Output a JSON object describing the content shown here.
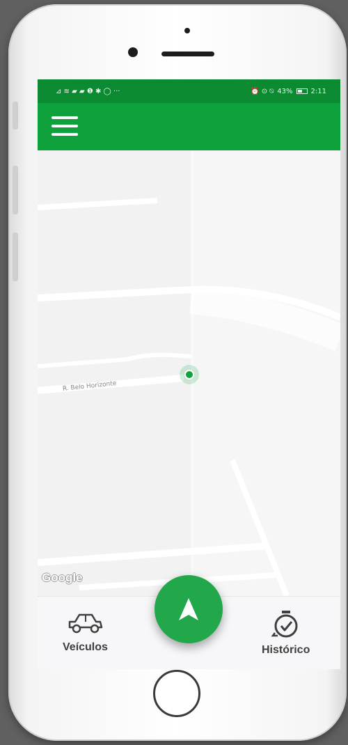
{
  "status_bar": {
    "left_icons": "⊿ ≋ ▰ ▰ ❶ ✱ ◯ ···",
    "right_icons": "⏰ ⊙ ⍉",
    "battery": "43%",
    "time": "2:11"
  },
  "app_bar": {
    "menu_icon": "hamburger-icon"
  },
  "map": {
    "street_name": "R. Belo Horizonte",
    "attribution": "Google",
    "marker_color": "#0fa13b"
  },
  "bottom_nav": {
    "vehicles_label": "Veículos",
    "vehicles_icon": "car-icon",
    "history_label": "Histórico",
    "history_icon": "timer-history-icon"
  },
  "fab": {
    "icon": "navigation-arrow-icon",
    "color": "#22a84a"
  },
  "theme": {
    "primary": "#0fa13b",
    "status_bar": "#0c8a32"
  }
}
